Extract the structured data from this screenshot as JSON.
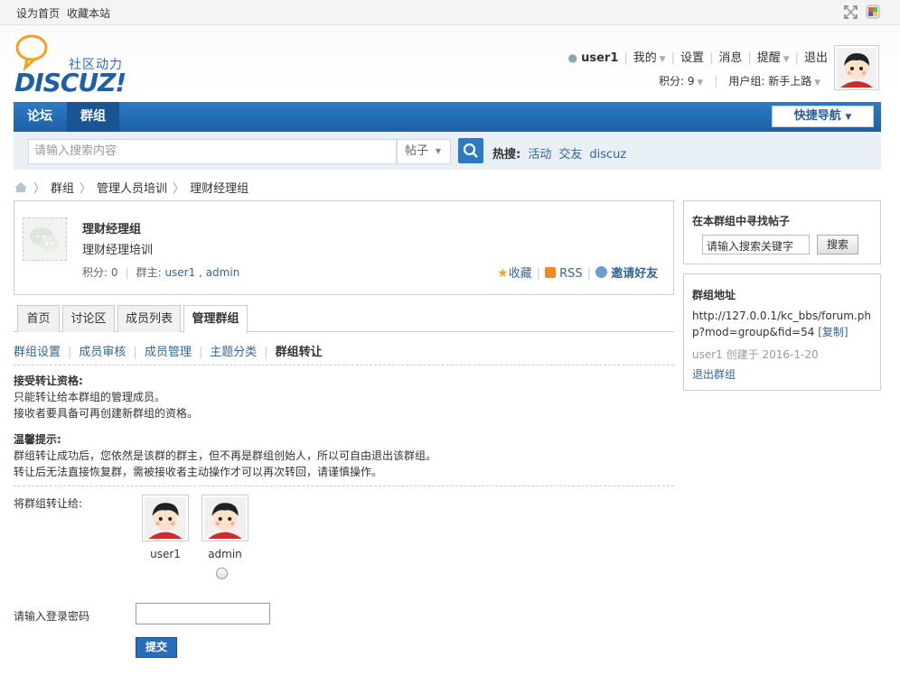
{
  "topbar": {
    "set_home": "设为首页",
    "bookmark": "收藏本站"
  },
  "logo": {
    "text": "DISCUZ!",
    "subtitle": "社区动力"
  },
  "user": {
    "name": "user1",
    "mine": "我的",
    "settings": "设置",
    "messages": "消息",
    "alerts": "提醒",
    "logout": "退出",
    "points": "积分: 9",
    "group": "用户组: 新手上路"
  },
  "nav": {
    "forum": "论坛",
    "group": "群组",
    "quick_nav": "快捷导航"
  },
  "search": {
    "placeholder": "请输入搜索内容",
    "type": "帖子",
    "hot_label": "热搜:",
    "hot": [
      "活动",
      "交友",
      "discuz"
    ]
  },
  "breadcrumb": {
    "items": [
      "群组",
      "管理人员培训",
      "理财经理组"
    ]
  },
  "group": {
    "name": "理财经理组",
    "desc": "理财经理培训",
    "points_label": "积分:",
    "points": "0",
    "owner_label": "群主:",
    "owners": [
      "user1",
      "admin"
    ],
    "favorite": "收藏",
    "rss": "RSS",
    "invite": "邀请好友"
  },
  "tabs": [
    "首页",
    "讨论区",
    "成员列表",
    "管理群组"
  ],
  "subnav": [
    "群组设置",
    "成员审核",
    "成员管理",
    "主题分类",
    "群组转让"
  ],
  "notice": {
    "h1": "接受转让资格:",
    "l1": "只能转让给本群组的管理成员。",
    "l2": "接收者要具备可再创建新群组的资格。",
    "h2": "温馨提示:",
    "l3": "群组转让成功后，您依然是该群的群主，但不再是群组创始人，所以可自由退出该群组。",
    "l4": "转让后无法直接恢复群，需被接收者主动操作才可以再次转回，请谨慎操作。"
  },
  "transfer": {
    "label": "将群组转让给:",
    "candidates": [
      "user1",
      "admin"
    ]
  },
  "password": {
    "label": "请输入登录密码"
  },
  "submit_label": "提交",
  "sidebar": {
    "find_title": "在本群组中寻找帖子",
    "keyword_placeholder": "请输入搜索关键字",
    "search_btn": "搜索",
    "addr_title": "群组地址",
    "url": "http://127.0.0.1/kc_bbs/forum.php?mod=group&fid=54",
    "copy": "[复制]",
    "creator": "user1",
    "created_label": "创建于",
    "created_date": "2016-1-20",
    "leave": "退出群组"
  }
}
